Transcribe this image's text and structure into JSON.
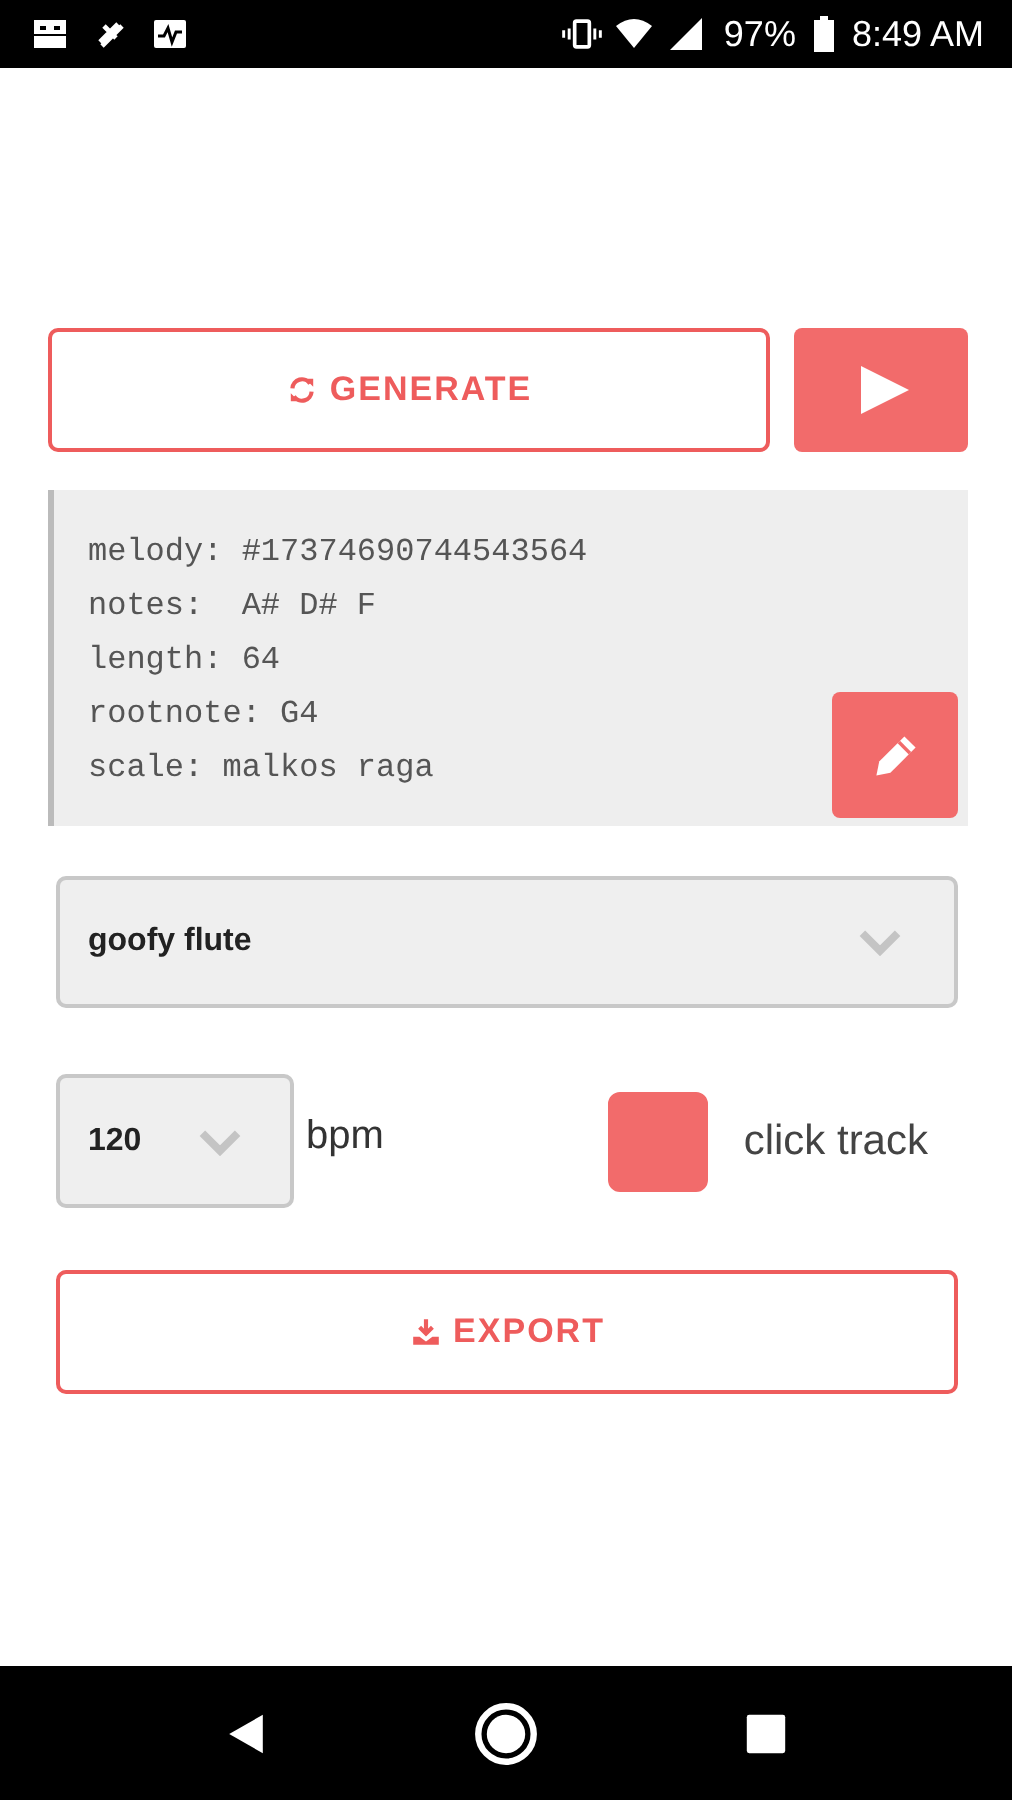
{
  "status_bar": {
    "battery": "97%",
    "time": "8:49 AM"
  },
  "generate_button": {
    "label": "GENERATE"
  },
  "info": {
    "lines": [
      "melody: #17374690744543564",
      "notes:  A# D# F",
      "length: 64",
      "rootnote: G4",
      "scale: malkos raga"
    ]
  },
  "instrument": {
    "value": "goofy flute"
  },
  "tempo": {
    "value": "120",
    "unit": "bpm"
  },
  "click_track": {
    "label": "click track",
    "checked": true
  },
  "export_button": {
    "label": "EXPORT"
  }
}
